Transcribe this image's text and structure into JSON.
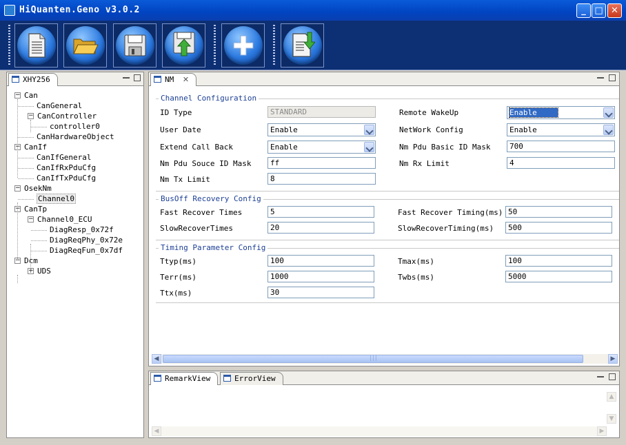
{
  "window": {
    "title": "HiQuanten.Geno v3.0.2",
    "minimize": "_",
    "maximize": "□",
    "close": "✕"
  },
  "toolbar": {
    "buttons": [
      {
        "name": "new",
        "icon": "document-icon"
      },
      {
        "name": "open",
        "icon": "folder-icon"
      },
      {
        "name": "save",
        "icon": "floppy-icon"
      },
      {
        "name": "export",
        "icon": "upload-icon"
      },
      {
        "name": "add",
        "icon": "plus-icon"
      },
      {
        "name": "import",
        "icon": "import-icon"
      }
    ]
  },
  "left_panel": {
    "tab": "XHY256",
    "tree": [
      {
        "label": "Can",
        "level": 0,
        "toggle": "−"
      },
      {
        "label": "CanGeneral",
        "level": 1
      },
      {
        "label": "CanController",
        "level": 1,
        "toggle": "−"
      },
      {
        "label": "controller0",
        "level": 2
      },
      {
        "label": "CanHardwareObject",
        "level": 1
      },
      {
        "label": "CanIf",
        "level": 0,
        "toggle": "−"
      },
      {
        "label": "CanIfGeneral",
        "level": 1
      },
      {
        "label": "CanIfRxPduCfg",
        "level": 1
      },
      {
        "label": "CanIfTxPduCfg",
        "level": 1
      },
      {
        "label": "OsekNm",
        "level": 0,
        "toggle": "−"
      },
      {
        "label": "Channel0",
        "level": 1,
        "selected": true
      },
      {
        "label": "CanTp",
        "level": 0,
        "toggle": "−"
      },
      {
        "label": "Channel0_ECU",
        "level": 1,
        "toggle": "−"
      },
      {
        "label": "DiagResp_0x72f",
        "level": 2
      },
      {
        "label": "DiagReqPhy_0x72e",
        "level": 2
      },
      {
        "label": "DiagReqFun_0x7df",
        "level": 2
      },
      {
        "label": "Dcm",
        "level": 0,
        "toggle": "−"
      },
      {
        "label": "UDS",
        "level": 1,
        "toggle": "+"
      }
    ]
  },
  "editor": {
    "tab": "NM",
    "tab_close": "✕",
    "channel_config": {
      "title": "Channel Configuration",
      "id_type_label": "ID Type",
      "id_type_value": "STANDARD",
      "remote_wakeup_label": "Remote WakeUp",
      "remote_wakeup_value": "Enable",
      "user_date_label": "User Date",
      "user_date_value": "Enable",
      "network_config_label": "NetWork Config",
      "network_config_value": "Enable",
      "extend_call_back_label": "Extend Call Back",
      "extend_call_back_value": "Enable",
      "nm_pdu_basic_id_mask_label": "Nm Pdu Basic ID Mask",
      "nm_pdu_basic_id_mask_value": "700",
      "nm_pdu_souce_id_mask_label": "Nm Pdu Souce ID Mask",
      "nm_pdu_souce_id_mask_value": "ff",
      "nm_rx_limit_label": "Nm Rx Limit",
      "nm_rx_limit_value": "4",
      "nm_tx_limit_label": "Nm Tx Limit",
      "nm_tx_limit_value": "8"
    },
    "busoff_config": {
      "title": "BusOff Recovery Config",
      "fast_recover_times_label": "Fast Recover Times",
      "fast_recover_times_value": "5",
      "fast_recover_timing_label": "Fast Recover Timing(ms)",
      "fast_recover_timing_value": "50",
      "slow_recover_times_label": "SlowRecoverTimes",
      "slow_recover_times_value": "20",
      "slow_recover_timing_label": "SlowRecoverTiming(ms)",
      "slow_recover_timing_value": "500"
    },
    "timing_config": {
      "title": "Timing Parameter Config",
      "ttyp_label": "Ttyp(ms)",
      "ttyp_value": "100",
      "tmax_label": "Tmax(ms)",
      "tmax_value": "100",
      "terr_label": "Terr(ms)",
      "terr_value": "1000",
      "twbs_label": "Twbs(ms)",
      "twbs_value": "5000",
      "ttx_label": "Ttx(ms)",
      "ttx_value": "30"
    }
  },
  "bottom_panel": {
    "tabs": [
      "RemarkView",
      "ErrorView"
    ]
  },
  "colors": {
    "titlebar": "#0144c1",
    "toolbar_bg": "#0d2f73",
    "group_title": "#1c3f94",
    "selection": "#316ac5"
  }
}
